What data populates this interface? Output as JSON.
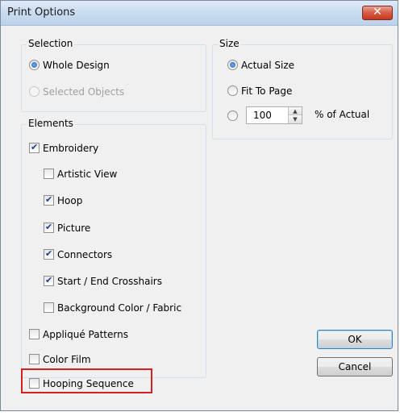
{
  "window": {
    "title": "Print Options",
    "close_glyph": "✕"
  },
  "selection": {
    "legend": "Selection",
    "options": [
      {
        "label": "Whole Design",
        "selected": true,
        "disabled": false
      },
      {
        "label": "Selected Objects",
        "selected": false,
        "disabled": true
      }
    ]
  },
  "size": {
    "legend": "Size",
    "options": [
      {
        "label": "Actual Size",
        "selected": true
      },
      {
        "label": "Fit To Page",
        "selected": false
      },
      {
        "label": "",
        "selected": false
      }
    ],
    "percent_value": "100",
    "percent_suffix": "% of Actual"
  },
  "elements": {
    "legend": "Elements",
    "items": [
      {
        "label": "Embroidery",
        "checked": true
      },
      {
        "label": "Artistic View",
        "checked": false
      },
      {
        "label": "Hoop",
        "checked": true
      },
      {
        "label": "Picture",
        "checked": true
      },
      {
        "label": "Connectors",
        "checked": true
      },
      {
        "label": "Start / End Crosshairs",
        "checked": true
      },
      {
        "label": "Background Color / Fabric",
        "checked": false
      },
      {
        "label": "Appliqué Patterns",
        "checked": false
      },
      {
        "label": "Color Film",
        "checked": false
      },
      {
        "label": "Hooping Sequence",
        "checked": false
      }
    ]
  },
  "buttons": {
    "ok": "OK",
    "cancel": "Cancel"
  },
  "colors": {
    "highlight": "#d42020",
    "title_bg": "#c9dbef",
    "close_bg": "#c3391f"
  }
}
